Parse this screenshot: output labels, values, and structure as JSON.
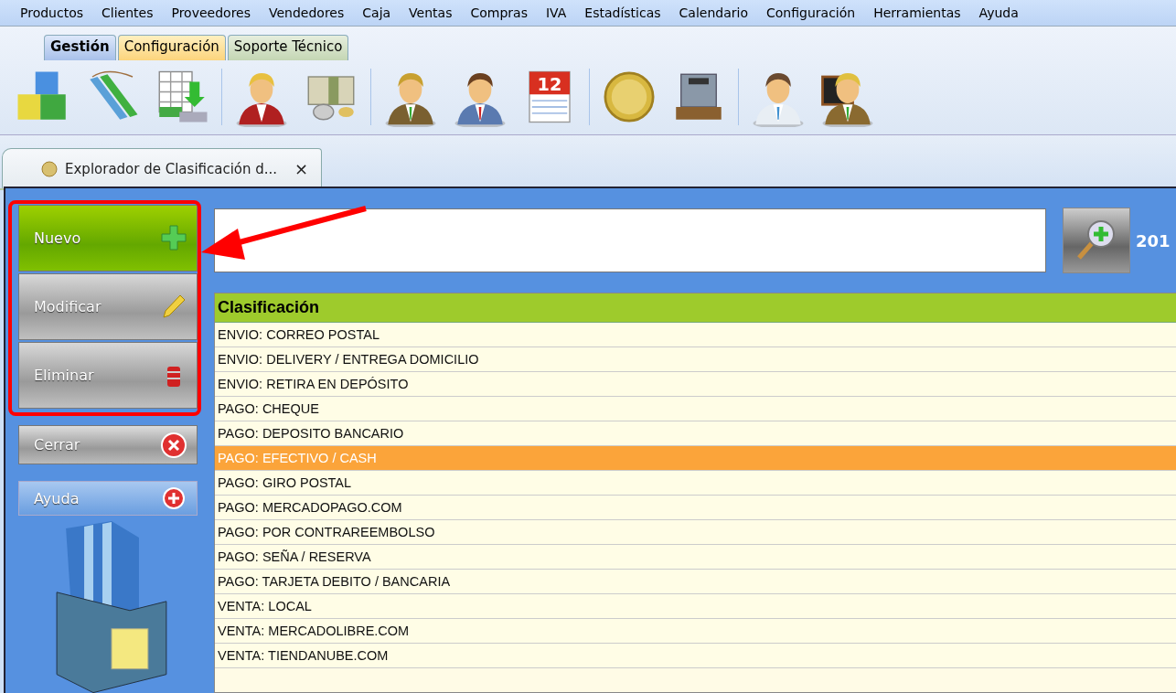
{
  "menu": [
    "Productos",
    "Clientes",
    "Proveedores",
    "Vendedores",
    "Caja",
    "Ventas",
    "Compras",
    "IVA",
    "Estadísticas",
    "Calendario",
    "Configuración",
    "Herramientas",
    "Ayuda"
  ],
  "ribbon_tabs": [
    {
      "label": "Gestión",
      "selected": true,
      "kind": "blue"
    },
    {
      "label": "Configuración",
      "selected": false,
      "kind": "orange"
    },
    {
      "label": "Soporte Técnico",
      "selected": false,
      "kind": "green"
    }
  ],
  "calendar_day": "12",
  "document_tab": {
    "title": "Explorador de Clasificación d...",
    "close": "×"
  },
  "actions": [
    {
      "label": "Nuevo",
      "kind": "new"
    },
    {
      "label": "Modificar",
      "kind": "edit"
    },
    {
      "label": "Eliminar",
      "kind": "delete"
    },
    {
      "label": "Cerrar",
      "kind": "close"
    },
    {
      "label": "Ayuda",
      "kind": "help"
    }
  ],
  "search": {
    "year": "201"
  },
  "table": {
    "column": "Clasificación",
    "rows": [
      {
        "text": "ENVIO: CORREO POSTAL",
        "selected": false
      },
      {
        "text": "ENVIO: DELIVERY / ENTREGA DOMICILIO",
        "selected": false
      },
      {
        "text": "ENVIO: RETIRA EN DEPÓSITO",
        "selected": false
      },
      {
        "text": "PAGO: CHEQUE",
        "selected": false
      },
      {
        "text": "PAGO: DEPOSITO BANCARIO",
        "selected": false
      },
      {
        "text": "PAGO: EFECTIVO / CASH",
        "selected": true
      },
      {
        "text": "PAGO: GIRO POSTAL",
        "selected": false
      },
      {
        "text": "PAGO: MERCADOPAGO.COM",
        "selected": false
      },
      {
        "text": "PAGO: POR CONTRAREEMBOLSO",
        "selected": false
      },
      {
        "text": "PAGO: SEÑA / RESERVA",
        "selected": false
      },
      {
        "text": "PAGO: TARJETA DEBITO / BANCARIA",
        "selected": false
      },
      {
        "text": "VENTA: LOCAL",
        "selected": false
      },
      {
        "text": "VENTA: MERCADOLIBRE.COM",
        "selected": false
      },
      {
        "text": "VENTA: TIENDANUBE.COM",
        "selected": false
      }
    ]
  }
}
